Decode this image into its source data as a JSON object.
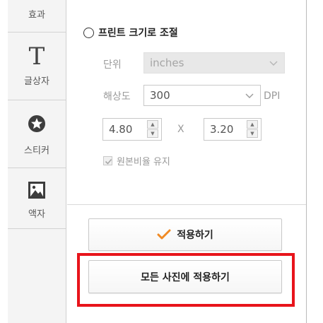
{
  "sidebar": {
    "items": [
      {
        "label": "효과",
        "icon": "effects"
      },
      {
        "label": "글상자",
        "icon": "text-T-icon"
      },
      {
        "label": "스티커",
        "icon": "star-badge-icon"
      },
      {
        "label": "액자",
        "icon": "picture-frame-icon"
      }
    ]
  },
  "resize": {
    "radio_label": "프린트 크기로 조절",
    "unit_label": "단위",
    "unit_value": "inches",
    "resolution_label": "해상도",
    "resolution_value": "300",
    "resolution_unit": "DPI",
    "width_value": "4.80",
    "x_label": "X",
    "height_value": "3.20",
    "keep_ratio_label": "원본비율 유지"
  },
  "actions": {
    "apply_label": "적용하기",
    "apply_all_label": "모든 사진에 적용하기"
  },
  "colors": {
    "highlight": "#e8141b",
    "check_accent": "#f08a24"
  }
}
